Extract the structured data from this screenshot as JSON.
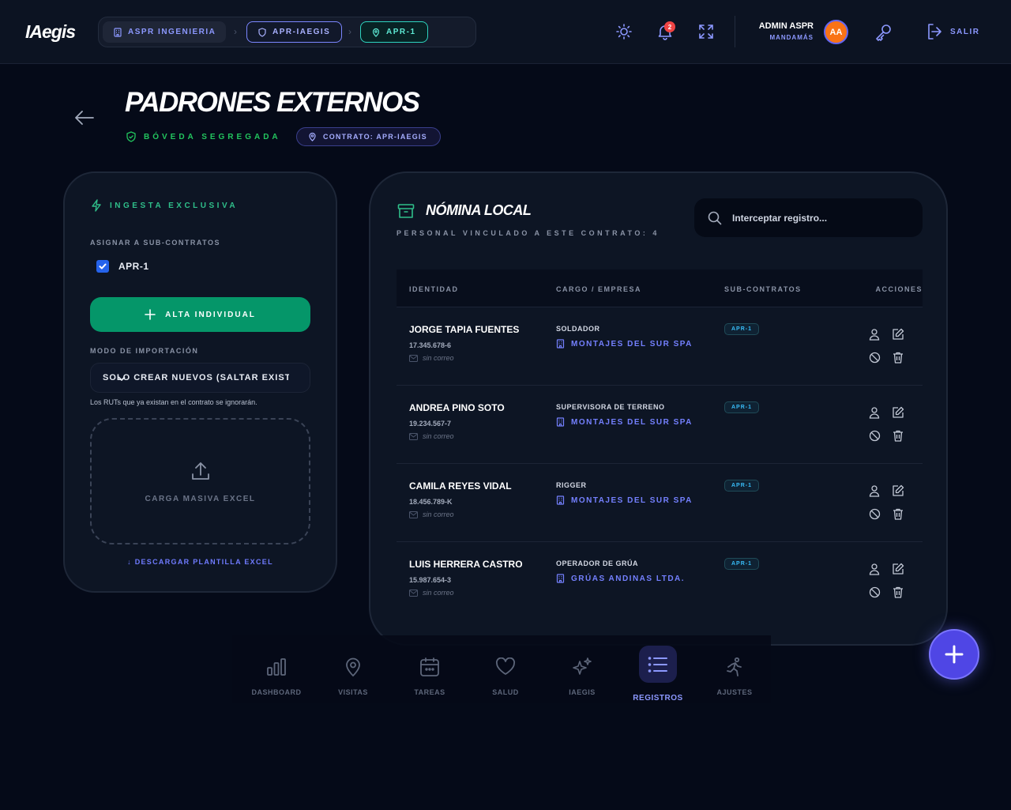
{
  "app": {
    "logo": "IAegis"
  },
  "breadcrumb": [
    {
      "label": "ASPR INGENIERIA"
    },
    {
      "label": "APR-IAEGIS"
    },
    {
      "label": "APR-1"
    }
  ],
  "topbar": {
    "notifications_count": "2",
    "user_name": "ADMIN ASPR",
    "user_role": "MANDAMÁS",
    "avatar_initials": "AA",
    "logout_label": "SALIR"
  },
  "page": {
    "title": "PADRONES EXTERNOS",
    "vault_label": "BÓVEDA SEGREGADA",
    "contract_label": "CONTRATO: APR-IAEGIS"
  },
  "ingest": {
    "title": "INGESTA EXCLUSIVA",
    "assign_label": "ASIGNAR A SUB-CONTRATOS",
    "subcontract_option": "APR-1",
    "subcontract_checked": true,
    "alta_button": "ALTA INDIVIDUAL",
    "mode_label": "MODO DE IMPORTACIÓN",
    "mode_selected": "SOLO CREAR NUEVOS (SALTAR EXISTENTES)",
    "mode_hint": "Los RUTs que ya existan en el contrato se ignorarán.",
    "dropzone_label": "CARGA MASIVA EXCEL",
    "download_link": "↓ DESCARGAR PLANTILLA EXCEL"
  },
  "roster": {
    "title": "NÓMINA LOCAL",
    "subtitle": "PERSONAL VINCULADO A ESTE CONTRATO: 4",
    "search_placeholder": "Interceptar registro...",
    "columns": {
      "identity": "IDENTIDAD",
      "role_company": "CARGO / EMPRESA",
      "subcontracts": "SUB-CONTRATOS",
      "actions": "ACCIONES"
    },
    "rows": [
      {
        "name": "JORGE TAPIA FUENTES",
        "rut": "17.345.678-6",
        "email": "sin correo",
        "role": "SOLDADOR",
        "company": "MONTAJES DEL SUR SPA",
        "subcontract": "APR-1"
      },
      {
        "name": "ANDREA PINO SOTO",
        "rut": "19.234.567-7",
        "email": "sin correo",
        "role": "SUPERVISORA DE TERRENO",
        "company": "MONTAJES DEL SUR SPA",
        "subcontract": "APR-1"
      },
      {
        "name": "CAMILA REYES VIDAL",
        "rut": "18.456.789-K",
        "email": "sin correo",
        "role": "RIGGER",
        "company": "MONTAJES DEL SUR SPA",
        "subcontract": "APR-1"
      },
      {
        "name": "LUIS HERRERA CASTRO",
        "rut": "15.987.654-3",
        "email": "sin correo",
        "role": "OPERADOR DE GRÚA",
        "company": "GRÚAS ANDINAS LTDA.",
        "subcontract": "APR-1"
      }
    ]
  },
  "nav": [
    {
      "label": "DASHBOARD",
      "icon": "bar-chart-icon"
    },
    {
      "label": "VISITAS",
      "icon": "map-pin-icon"
    },
    {
      "label": "TAREAS",
      "icon": "calendar-icon"
    },
    {
      "label": "SALUD",
      "icon": "heart-icon"
    },
    {
      "label": "IAEGIS",
      "icon": "sparkles-icon"
    },
    {
      "label": "REGISTROS",
      "icon": "list-icon",
      "active": true
    },
    {
      "label": "AJUSTES",
      "icon": "running-person-icon"
    }
  ],
  "colors": {
    "accent": "#6366f1",
    "success": "#059669",
    "teal": "#2dd4bf",
    "background": "#050a18"
  }
}
